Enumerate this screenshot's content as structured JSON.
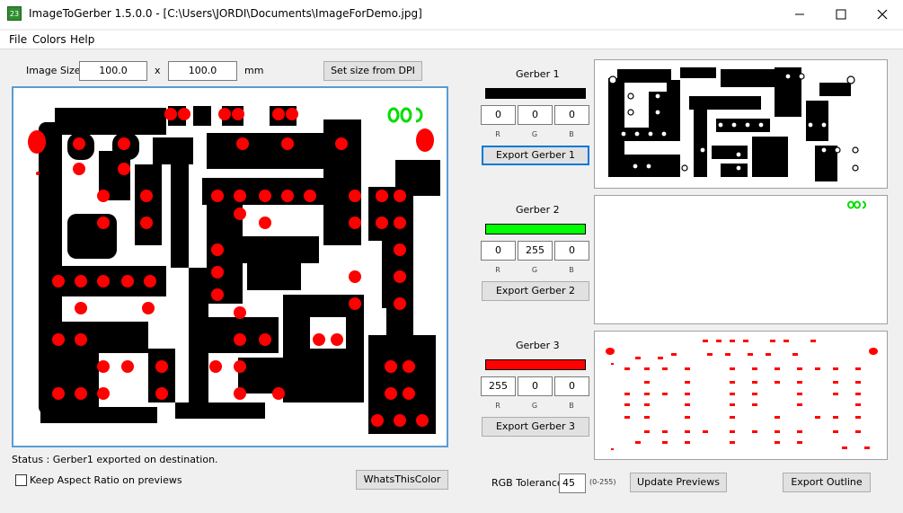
{
  "window": {
    "title": "ImageToGerber 1.5.0.0 - [C:\\Users\\JORDI\\Documents\\ImageForDemo.jpg]",
    "icon_text": "23",
    "controls": [
      "minimize-icon",
      "maximize-icon",
      "close-icon"
    ]
  },
  "menu": {
    "items": [
      "File",
      "Colors",
      "Help"
    ]
  },
  "image_size": {
    "label": "Image Size:",
    "width": "100.0",
    "separator": "x",
    "height": "100.0",
    "unit": "mm",
    "dpi_button": "Set size from DPI"
  },
  "gerbers": [
    {
      "title": "Gerber 1",
      "color": "#000000",
      "r": "0",
      "g": "0",
      "b": "0",
      "export_label": "Export Gerber 1"
    },
    {
      "title": "Gerber 2",
      "color": "#00ff00",
      "r": "0",
      "g": "255",
      "b": "0",
      "export_label": "Export Gerber 2"
    },
    {
      "title": "Gerber 3",
      "color": "#ff0000",
      "r": "255",
      "g": "0",
      "b": "0",
      "export_label": "Export Gerber 3"
    }
  ],
  "channel_labels": {
    "r": "R",
    "g": "G",
    "b": "B"
  },
  "status": {
    "text": "Status :  Gerber1 exported on destination."
  },
  "keep_aspect": {
    "label": "Keep Aspect Ratio on previews",
    "checked": false
  },
  "whats_color_button": "WhatsThisColor",
  "tolerance": {
    "label": "RGB Tolerance",
    "value": "45",
    "range": "(0-255)"
  },
  "update_button": "Update Previews",
  "outline_button": "Export Outline",
  "colors": {
    "accent": "#0078d7",
    "pcb_black": "#000000",
    "pad_red": "#ff0000",
    "logo_green": "#00dd00",
    "selection_border": "#5b9bd5"
  }
}
